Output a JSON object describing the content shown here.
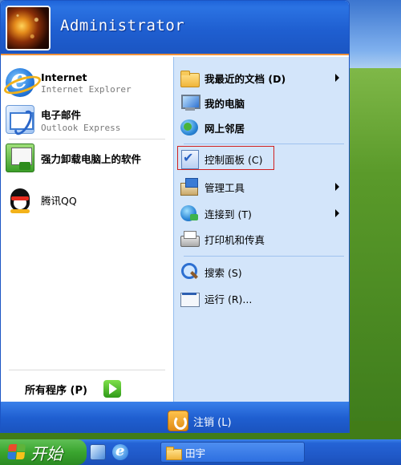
{
  "user": {
    "name": "Administrator"
  },
  "left_items": [
    {
      "title": "Internet",
      "subtitle": "Internet Explorer",
      "icon": "ie-icon"
    },
    {
      "title": "电子邮件",
      "subtitle": "Outlook Express",
      "icon": "outlook-express-icon"
    },
    {
      "title": "强力卸载电脑上的软件",
      "icon": "uninstall-icon"
    },
    {
      "title": "腾讯QQ",
      "icon": "qq-icon"
    }
  ],
  "all_programs": {
    "label": "所有程序 (P)",
    "icon": "green-arrow-icon"
  },
  "right_items": [
    {
      "label": "我最近的文档 (D)",
      "icon": "folder-icon",
      "has_submenu": true
    },
    {
      "label": "我的电脑",
      "icon": "computer-icon",
      "has_submenu": false
    },
    {
      "label": "网上邻居",
      "icon": "network-icon",
      "has_submenu": false
    },
    {
      "label": "控制面板 (C)",
      "icon": "control-panel-icon",
      "has_submenu": false,
      "highlighted": true
    },
    {
      "label": "管理工具",
      "icon": "admin-tools-icon",
      "has_submenu": true
    },
    {
      "label": "连接到 (T)",
      "icon": "connect-icon",
      "has_submenu": true
    },
    {
      "label": "打印机和传真",
      "icon": "printer-icon",
      "has_submenu": false
    },
    {
      "label": "搜索 (S)",
      "icon": "search-icon",
      "has_submenu": false
    },
    {
      "label": "运行 (R)...",
      "icon": "run-icon",
      "has_submenu": false
    }
  ],
  "footer": {
    "logoff_label": "注销 (L)"
  },
  "taskbar": {
    "start_label": "开始",
    "quick_launch": [
      "show-desktop-icon",
      "ie-icon"
    ],
    "task_button": {
      "label": "田宇",
      "icon": "folder-icon"
    }
  },
  "colors": {
    "header_blue": "#1f5fd1",
    "right_panel": "#d3e5fa",
    "accent_orange": "#f0923a",
    "highlight_red": "#d02020",
    "start_green": "#3aa52f"
  }
}
